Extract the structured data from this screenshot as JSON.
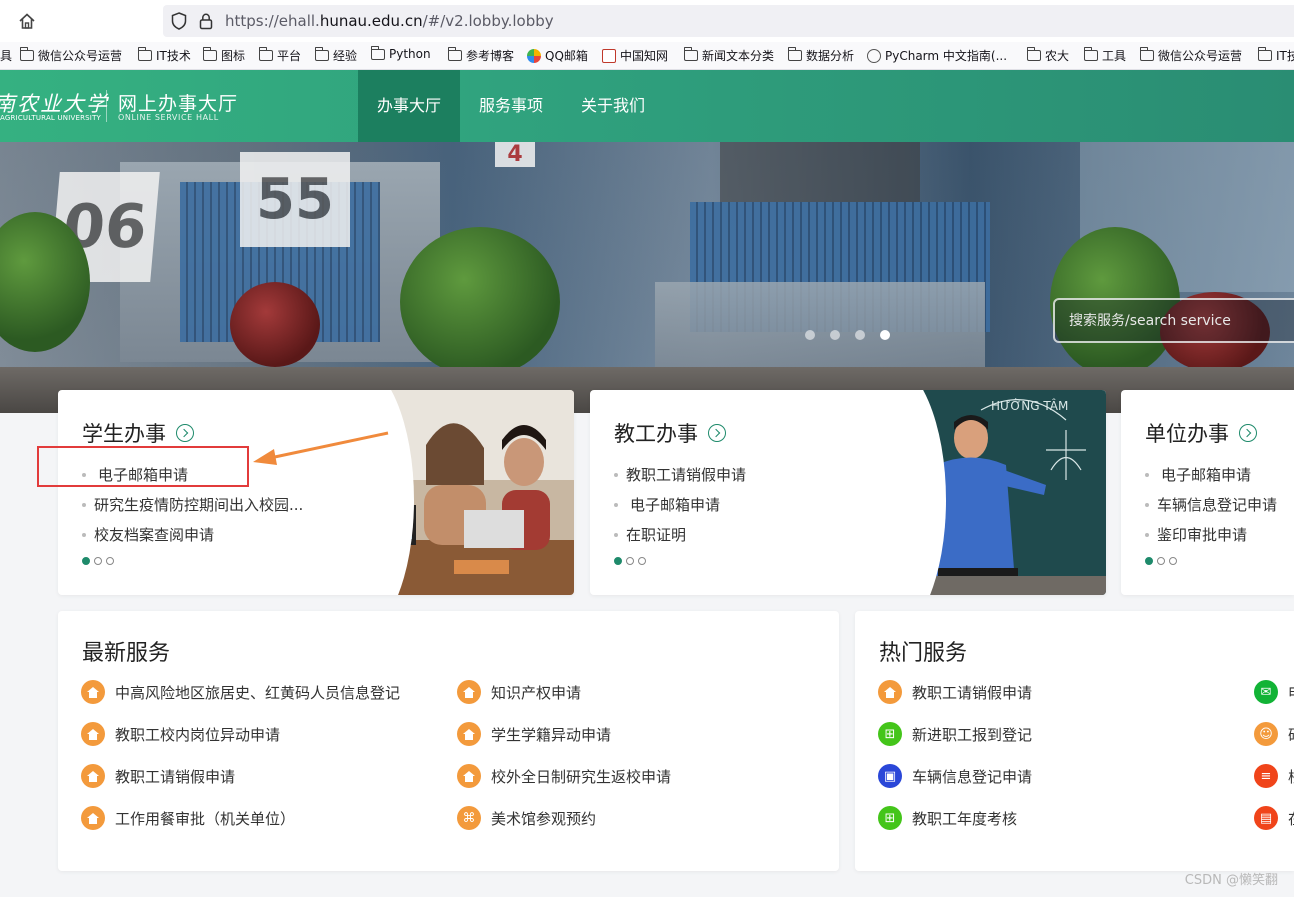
{
  "browser": {
    "url_prefix": "https://ehall.",
    "url_domain": "hunau.edu.cn",
    "url_suffix": "/#/v2.lobby.lobby",
    "bookmarks": [
      "具",
      "微信公众号运营",
      "IT技术",
      "图标",
      "平台",
      "经验",
      "Python",
      "参考博客",
      "QQ邮箱",
      "中国知网",
      "新闻文本分类",
      "数据分析",
      "PyCharm 中文指南(...",
      "农大",
      "工具",
      "微信公众号运营",
      "IT技"
    ]
  },
  "header": {
    "logo_cn": "南农业大学",
    "logo_en": "AGRICULTURAL UNIVERSITY",
    "title": "网上办事大厅",
    "subtitle": "ONLINE SERVICE HALL",
    "nav": [
      "办事大厅",
      "服务事项",
      "关于我们"
    ],
    "active_nav": "办事大厅"
  },
  "banner": {
    "card_numbers": [
      "0",
      "6",
      "5",
      "5",
      "4"
    ],
    "search_placeholder": "搜索服务/search service",
    "slide_count": 4,
    "active_slide": 4
  },
  "cards": [
    {
      "title": "学生办事",
      "items": [
        "电子邮箱申请",
        "研究生疫情防控期间出入校园...",
        "校友档案查阅申请"
      ]
    },
    {
      "title": "教工办事",
      "items": [
        "教职工请销假申请",
        "电子邮箱申请",
        "在职证明"
      ]
    },
    {
      "title": "单位办事",
      "items": [
        "电子邮箱申请",
        "车辆信息登记申请",
        "鉴印审批申请"
      ]
    }
  ],
  "chalkboard_text": "HƯỚNG TÂM",
  "latest": {
    "title": "最新服务",
    "col1": [
      "中高风险地区旅居史、红黄码人员信息登记",
      "教职工校内岗位异动申请",
      "教职工请销假申请",
      "工作用餐审批（机关单位）"
    ],
    "col2": [
      "知识产权申请",
      "学生学籍异动申请",
      "校外全日制研究生返校申请",
      "美术馆参观预约"
    ]
  },
  "hot": {
    "title": "热门服务",
    "col1": [
      "教职工请销假申请",
      "新进职工报到登记",
      "车辆信息登记申请",
      "教职工年度考核"
    ],
    "col2": [
      "申",
      "研",
      "校",
      "在"
    ]
  },
  "watermark": "CSDN @懒笑翻",
  "colors": {
    "brand": "#2fa07d",
    "active_nav": "#1c7f5f",
    "annotation": "#e23b3b",
    "arrow": "#f08a3c"
  }
}
